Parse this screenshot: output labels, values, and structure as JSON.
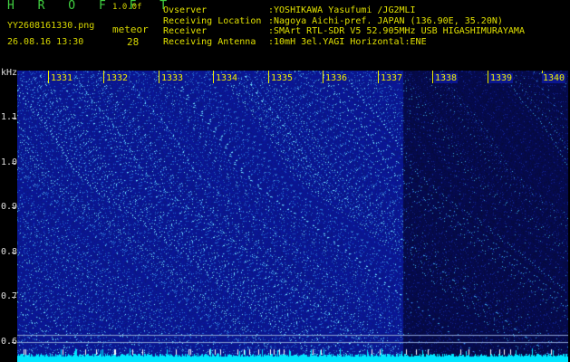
{
  "header": {
    "logo": "H R O F F T",
    "version": "1.0.0f",
    "filename": "YY2608161330.png",
    "datetime": "26.08.16 13:30",
    "meteor_label": "meteor",
    "meteor_count": "28"
  },
  "info": [
    {
      "key": "Ovserver",
      "value": ":YOSHIKAWA Yasufumi /JG2MLI"
    },
    {
      "key": "Receiving Location",
      "value": ":Nagoya Aichi-pref. JAPAN (136.90E, 35.20N)"
    },
    {
      "key": "Receiver",
      "value": ":SMArt RTL-SDR V5 52.905MHz USB HIGASHIMURAYAMA"
    },
    {
      "key": "Receiving Antenna",
      "value": ":10mH 3el.YAGI Horizontal:ENE"
    }
  ],
  "axis": {
    "y_unit": "kHz",
    "y_ticks": [
      "1.1",
      "1.0",
      "0.9",
      "0.8",
      "0.7",
      "0.6"
    ],
    "x_ticks": [
      "1331",
      "1332",
      "1333",
      "1334",
      "1335",
      "1336",
      "1337",
      "1338",
      "1339",
      "1340"
    ]
  },
  "colors": {
    "background": "#000000",
    "spectrogram": "#0b1690",
    "header_text": "#e0e000",
    "logo": "#40d040",
    "noise_floor": "#00e5ff"
  }
}
